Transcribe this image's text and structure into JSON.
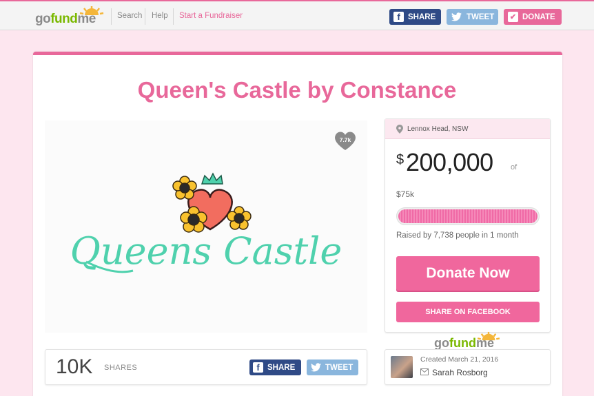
{
  "header": {
    "logo": "gofundme",
    "nav": [
      {
        "label": "Search"
      },
      {
        "label": "Help"
      },
      {
        "label": "Start a Fundraiser"
      }
    ],
    "share_label": "SHARE",
    "tweet_label": "TWEET",
    "donate_label": "DONATE"
  },
  "campaign": {
    "title": "Queen's Castle by Constance",
    "hearts": "7.7k",
    "image_text": "Queens Castle"
  },
  "donation": {
    "location": "Lennox Head, NSW",
    "currency_symbol": "$",
    "goal": "200,000",
    "of_label": "of",
    "raised": "$75k",
    "progress_fraction": 1.0,
    "raised_by": "Raised by 7,738 people in 1 month",
    "donate_now_label": "Donate Now",
    "share_facebook_label": "SHARE ON FACEBOOK"
  },
  "shares": {
    "count": "10K",
    "label": "SHARES",
    "share_label": "SHARE",
    "tweet_label": "TWEET"
  },
  "organizer": {
    "created": "Created March 21, 2016",
    "name": "Sarah Rosborg"
  },
  "colors": {
    "brand_pink": "#e8689a",
    "facebook_blue": "#2f4a86",
    "twitter_blue": "#8ab6dd",
    "logo_green": "#7ab800",
    "script_teal": "#4fd1ad"
  }
}
